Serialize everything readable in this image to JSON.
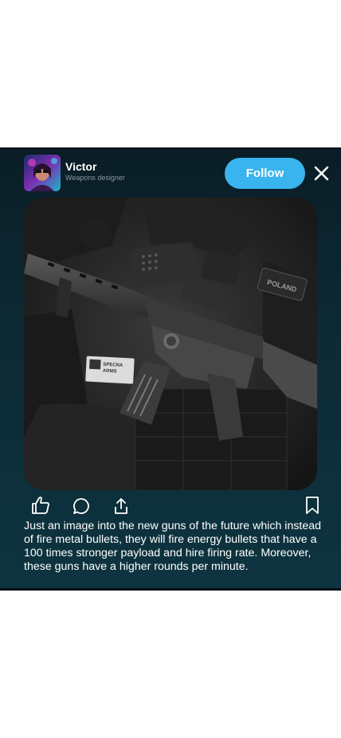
{
  "post": {
    "author": {
      "name": "Victor",
      "role": "Weapons designer",
      "avatar_icon": "profile-avatar"
    },
    "follow_label": "Follow",
    "close_icon": "close-icon",
    "image": {
      "patch_poland": "POLAND",
      "patch_brand_line1": "SPECNA",
      "patch_brand_line2": "ARMS"
    },
    "actions": {
      "like_icon": "thumbs-up-icon",
      "comment_icon": "comment-icon",
      "share_icon": "share-icon",
      "bookmark_icon": "bookmark-icon"
    },
    "caption": "Just an image into the new guns of the future which instead of fire metal bullets, they will fire energy bullets that have a 100 times stronger payload and hire firing rate. Moreover, these guns have a higher rounds per minute.",
    "colors": {
      "accent": "#3ab4ee",
      "card_bg": "#0d2a34"
    }
  }
}
